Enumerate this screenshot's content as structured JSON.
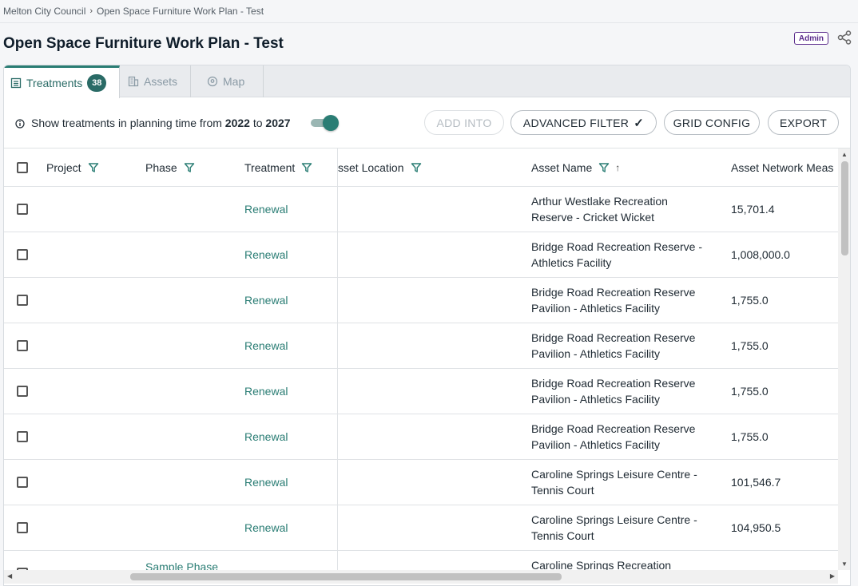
{
  "breadcrumb": {
    "root": "Melton City Council",
    "separator": "›",
    "current": "Open Space Furniture Work Plan - Test"
  },
  "page": {
    "title": "Open Space Furniture Work Plan - Test",
    "role_badge": "Admin"
  },
  "tabs": [
    {
      "label": "Treatments",
      "count": "38",
      "icon": "list-icon"
    },
    {
      "label": "Assets",
      "icon": "building-icon"
    },
    {
      "label": "Map",
      "icon": "map-pin-icon"
    }
  ],
  "toolbar": {
    "filter_prefix": "Show treatments in planning time from",
    "year_from": "2022",
    "word_to": "to",
    "year_to": "2027",
    "toggle_on": true,
    "add_into": "ADD INTO",
    "advanced_filter": "ADVANCED FILTER",
    "advanced_filter_check": "✓",
    "grid_config": "GRID CONFIG",
    "export": "EXPORT"
  },
  "columns": {
    "project": "Project",
    "phase": "Phase",
    "treatment": "Treatment",
    "asset_location": "sset Location",
    "asset_name": "Asset Name",
    "asset_network_measure": "Asset Network Meas"
  },
  "rows": [
    {
      "phase": "",
      "treatment": "Renewal",
      "asset_name_1": "Arthur Westlake Recreation",
      "asset_name_2": "Reserve - Cricket Wicket",
      "measure": "15,701.4"
    },
    {
      "phase": "",
      "treatment": "Renewal",
      "asset_name_1": "Bridge Road Recreation Reserve -",
      "asset_name_2": "Athletics Facility",
      "measure": "1,008,000.0"
    },
    {
      "phase": "",
      "treatment": "Renewal",
      "asset_name_1": "Bridge Road Recreation Reserve",
      "asset_name_2": "Pavilion - Athletics Facility",
      "measure": "1,755.0"
    },
    {
      "phase": "",
      "treatment": "Renewal",
      "asset_name_1": "Bridge Road Recreation Reserve",
      "asset_name_2": "Pavilion - Athletics Facility",
      "measure": "1,755.0"
    },
    {
      "phase": "",
      "treatment": "Renewal",
      "asset_name_1": "Bridge Road Recreation Reserve",
      "asset_name_2": "Pavilion - Athletics Facility",
      "measure": "1,755.0"
    },
    {
      "phase": "",
      "treatment": "Renewal",
      "asset_name_1": "Bridge Road Recreation Reserve",
      "asset_name_2": "Pavilion - Athletics Facility",
      "measure": "1,755.0"
    },
    {
      "phase": "",
      "treatment": "Renewal",
      "asset_name_1": "Caroline Springs Leisure Centre -",
      "asset_name_2": "Tennis Court",
      "measure": "101,546.7"
    },
    {
      "phase": "",
      "treatment": "Renewal",
      "asset_name_1": "Caroline Springs Leisure Centre -",
      "asset_name_2": "Tennis Court",
      "measure": "104,950.5"
    },
    {
      "phase": "Sample Phase",
      "treatment": "",
      "asset_name_1": "Caroline Springs Recreation",
      "asset_name_2": "",
      "measure": ""
    }
  ]
}
